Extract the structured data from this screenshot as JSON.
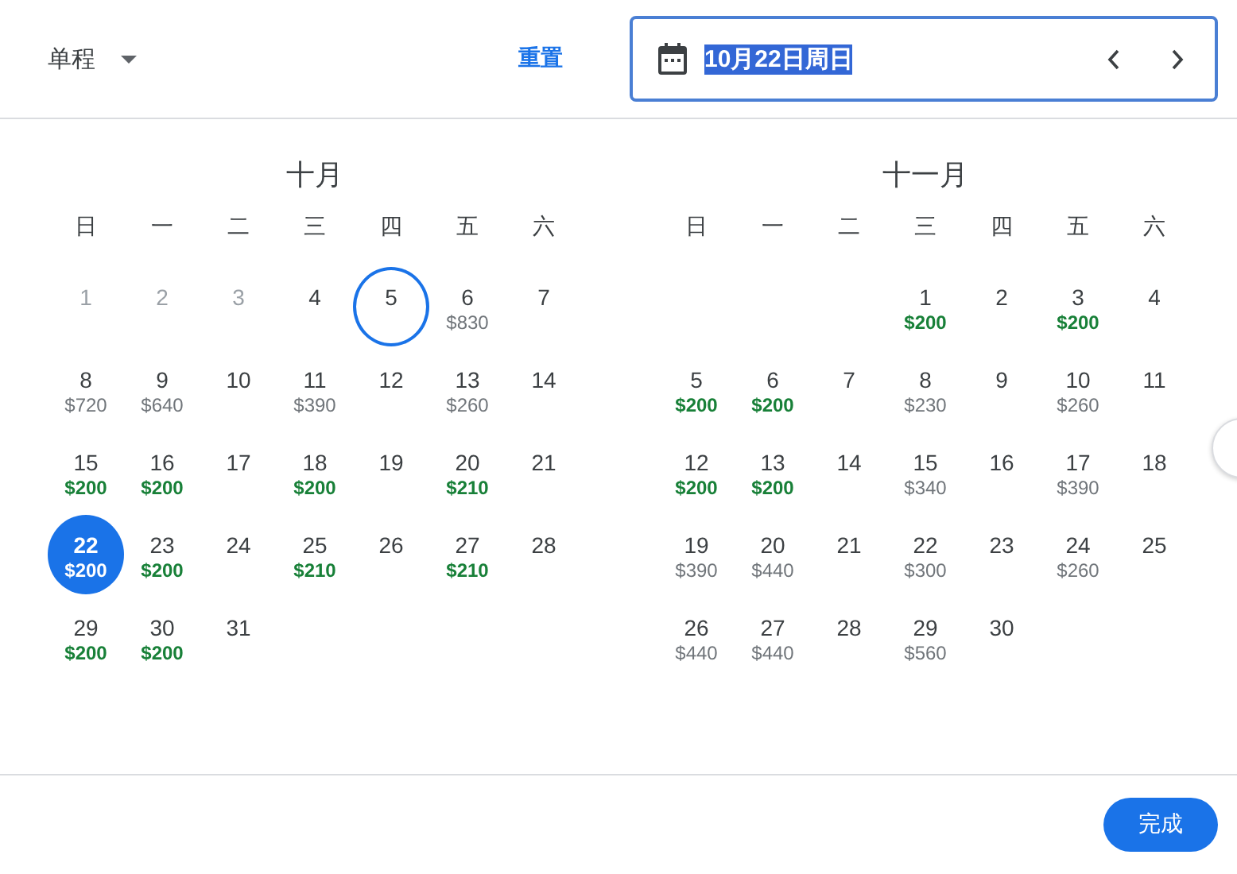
{
  "trip_type": {
    "label": "单程"
  },
  "reset_link": {
    "label": "重置"
  },
  "date_field": {
    "value": "10月22日周日",
    "text_selected": true
  },
  "months": [
    {
      "title": "十月",
      "weekdays": [
        "日",
        "一",
        "二",
        "三",
        "四",
        "五",
        "六"
      ],
      "weeks": [
        [
          {
            "day": "1",
            "disabled": true,
            "today": false,
            "selected": false
          },
          {
            "day": "2",
            "disabled": true,
            "today": false,
            "selected": false
          },
          {
            "day": "3",
            "disabled": true,
            "today": false,
            "selected": false
          },
          {
            "day": "4",
            "disabled": false,
            "today": false,
            "selected": false
          },
          {
            "day": "5",
            "disabled": false,
            "today": true,
            "selected": false
          },
          {
            "day": "6",
            "disabled": false,
            "today": false,
            "selected": false,
            "price": "$830",
            "cheap": false
          },
          {
            "day": "7",
            "disabled": false,
            "today": false,
            "selected": false
          }
        ],
        [
          {
            "day": "8",
            "disabled": false,
            "today": false,
            "selected": false,
            "price": "$720",
            "cheap": false
          },
          {
            "day": "9",
            "disabled": false,
            "today": false,
            "selected": false,
            "price": "$640",
            "cheap": false
          },
          {
            "day": "10",
            "disabled": false,
            "today": false,
            "selected": false
          },
          {
            "day": "11",
            "disabled": false,
            "today": false,
            "selected": false,
            "price": "$390",
            "cheap": false
          },
          {
            "day": "12",
            "disabled": false,
            "today": false,
            "selected": false
          },
          {
            "day": "13",
            "disabled": false,
            "today": false,
            "selected": false,
            "price": "$260",
            "cheap": false
          },
          {
            "day": "14",
            "disabled": false,
            "today": false,
            "selected": false
          }
        ],
        [
          {
            "day": "15",
            "disabled": false,
            "today": false,
            "selected": false,
            "price": "$200",
            "cheap": true
          },
          {
            "day": "16",
            "disabled": false,
            "today": false,
            "selected": false,
            "price": "$200",
            "cheap": true
          },
          {
            "day": "17",
            "disabled": false,
            "today": false,
            "selected": false
          },
          {
            "day": "18",
            "disabled": false,
            "today": false,
            "selected": false,
            "price": "$200",
            "cheap": true
          },
          {
            "day": "19",
            "disabled": false,
            "today": false,
            "selected": false
          },
          {
            "day": "20",
            "disabled": false,
            "today": false,
            "selected": false,
            "price": "$210",
            "cheap": true
          },
          {
            "day": "21",
            "disabled": false,
            "today": false,
            "selected": false
          }
        ],
        [
          {
            "day": "22",
            "disabled": false,
            "today": false,
            "selected": true,
            "price": "$200",
            "cheap": true
          },
          {
            "day": "23",
            "disabled": false,
            "today": false,
            "selected": false,
            "price": "$200",
            "cheap": true
          },
          {
            "day": "24",
            "disabled": false,
            "today": false,
            "selected": false
          },
          {
            "day": "25",
            "disabled": false,
            "today": false,
            "selected": false,
            "price": "$210",
            "cheap": true
          },
          {
            "day": "26",
            "disabled": false,
            "today": false,
            "selected": false
          },
          {
            "day": "27",
            "disabled": false,
            "today": false,
            "selected": false,
            "price": "$210",
            "cheap": true
          },
          {
            "day": "28",
            "disabled": false,
            "today": false,
            "selected": false
          }
        ],
        [
          {
            "day": "29",
            "disabled": false,
            "today": false,
            "selected": false,
            "price": "$200",
            "cheap": true
          },
          {
            "day": "30",
            "disabled": false,
            "today": false,
            "selected": false,
            "price": "$200",
            "cheap": true
          },
          {
            "day": "31",
            "disabled": false,
            "today": false,
            "selected": false
          }
        ]
      ]
    },
    {
      "title": "十一月",
      "weekdays": [
        "日",
        "一",
        "二",
        "三",
        "四",
        "五",
        "六"
      ],
      "weeks": [
        [
          {
            "day": "1",
            "disabled": false,
            "today": false,
            "selected": false,
            "price": "$200",
            "cheap": true
          },
          {
            "day": "2",
            "disabled": false,
            "today": false,
            "selected": false
          },
          {
            "day": "3",
            "disabled": false,
            "today": false,
            "selected": false,
            "price": "$200",
            "cheap": true
          },
          {
            "day": "4",
            "disabled": false,
            "today": false,
            "selected": false
          }
        ],
        [
          {
            "day": "5",
            "disabled": false,
            "today": false,
            "selected": false,
            "price": "$200",
            "cheap": true
          },
          {
            "day": "6",
            "disabled": false,
            "today": false,
            "selected": false,
            "price": "$200",
            "cheap": true
          },
          {
            "day": "7",
            "disabled": false,
            "today": false,
            "selected": false
          },
          {
            "day": "8",
            "disabled": false,
            "today": false,
            "selected": false,
            "price": "$230",
            "cheap": false
          },
          {
            "day": "9",
            "disabled": false,
            "today": false,
            "selected": false
          },
          {
            "day": "10",
            "disabled": false,
            "today": false,
            "selected": false,
            "price": "$260",
            "cheap": false
          },
          {
            "day": "11",
            "disabled": false,
            "today": false,
            "selected": false
          }
        ],
        [
          {
            "day": "12",
            "disabled": false,
            "today": false,
            "selected": false,
            "price": "$200",
            "cheap": true
          },
          {
            "day": "13",
            "disabled": false,
            "today": false,
            "selected": false,
            "price": "$200",
            "cheap": true
          },
          {
            "day": "14",
            "disabled": false,
            "today": false,
            "selected": false
          },
          {
            "day": "15",
            "disabled": false,
            "today": false,
            "selected": false,
            "price": "$340",
            "cheap": false
          },
          {
            "day": "16",
            "disabled": false,
            "today": false,
            "selected": false
          },
          {
            "day": "17",
            "disabled": false,
            "today": false,
            "selected": false,
            "price": "$390",
            "cheap": false
          },
          {
            "day": "18",
            "disabled": false,
            "today": false,
            "selected": false
          }
        ],
        [
          {
            "day": "19",
            "disabled": false,
            "today": false,
            "selected": false,
            "price": "$390",
            "cheap": false
          },
          {
            "day": "20",
            "disabled": false,
            "today": false,
            "selected": false,
            "price": "$440",
            "cheap": false
          },
          {
            "day": "21",
            "disabled": false,
            "today": false,
            "selected": false
          },
          {
            "day": "22",
            "disabled": false,
            "today": false,
            "selected": false,
            "price": "$300",
            "cheap": false
          },
          {
            "day": "23",
            "disabled": false,
            "today": false,
            "selected": false
          },
          {
            "day": "24",
            "disabled": false,
            "today": false,
            "selected": false,
            "price": "$260",
            "cheap": false
          },
          {
            "day": "25",
            "disabled": false,
            "today": false,
            "selected": false
          }
        ],
        [
          {
            "day": "26",
            "disabled": false,
            "today": false,
            "selected": false,
            "price": "$440",
            "cheap": false
          },
          {
            "day": "27",
            "disabled": false,
            "today": false,
            "selected": false,
            "price": "$440",
            "cheap": false
          },
          {
            "day": "28",
            "disabled": false,
            "today": false,
            "selected": false
          },
          {
            "day": "29",
            "disabled": false,
            "today": false,
            "selected": false,
            "price": "$560",
            "cheap": false
          },
          {
            "day": "30",
            "disabled": false,
            "today": false,
            "selected": false
          }
        ]
      ]
    }
  ],
  "done_button": {
    "label": "完成"
  }
}
